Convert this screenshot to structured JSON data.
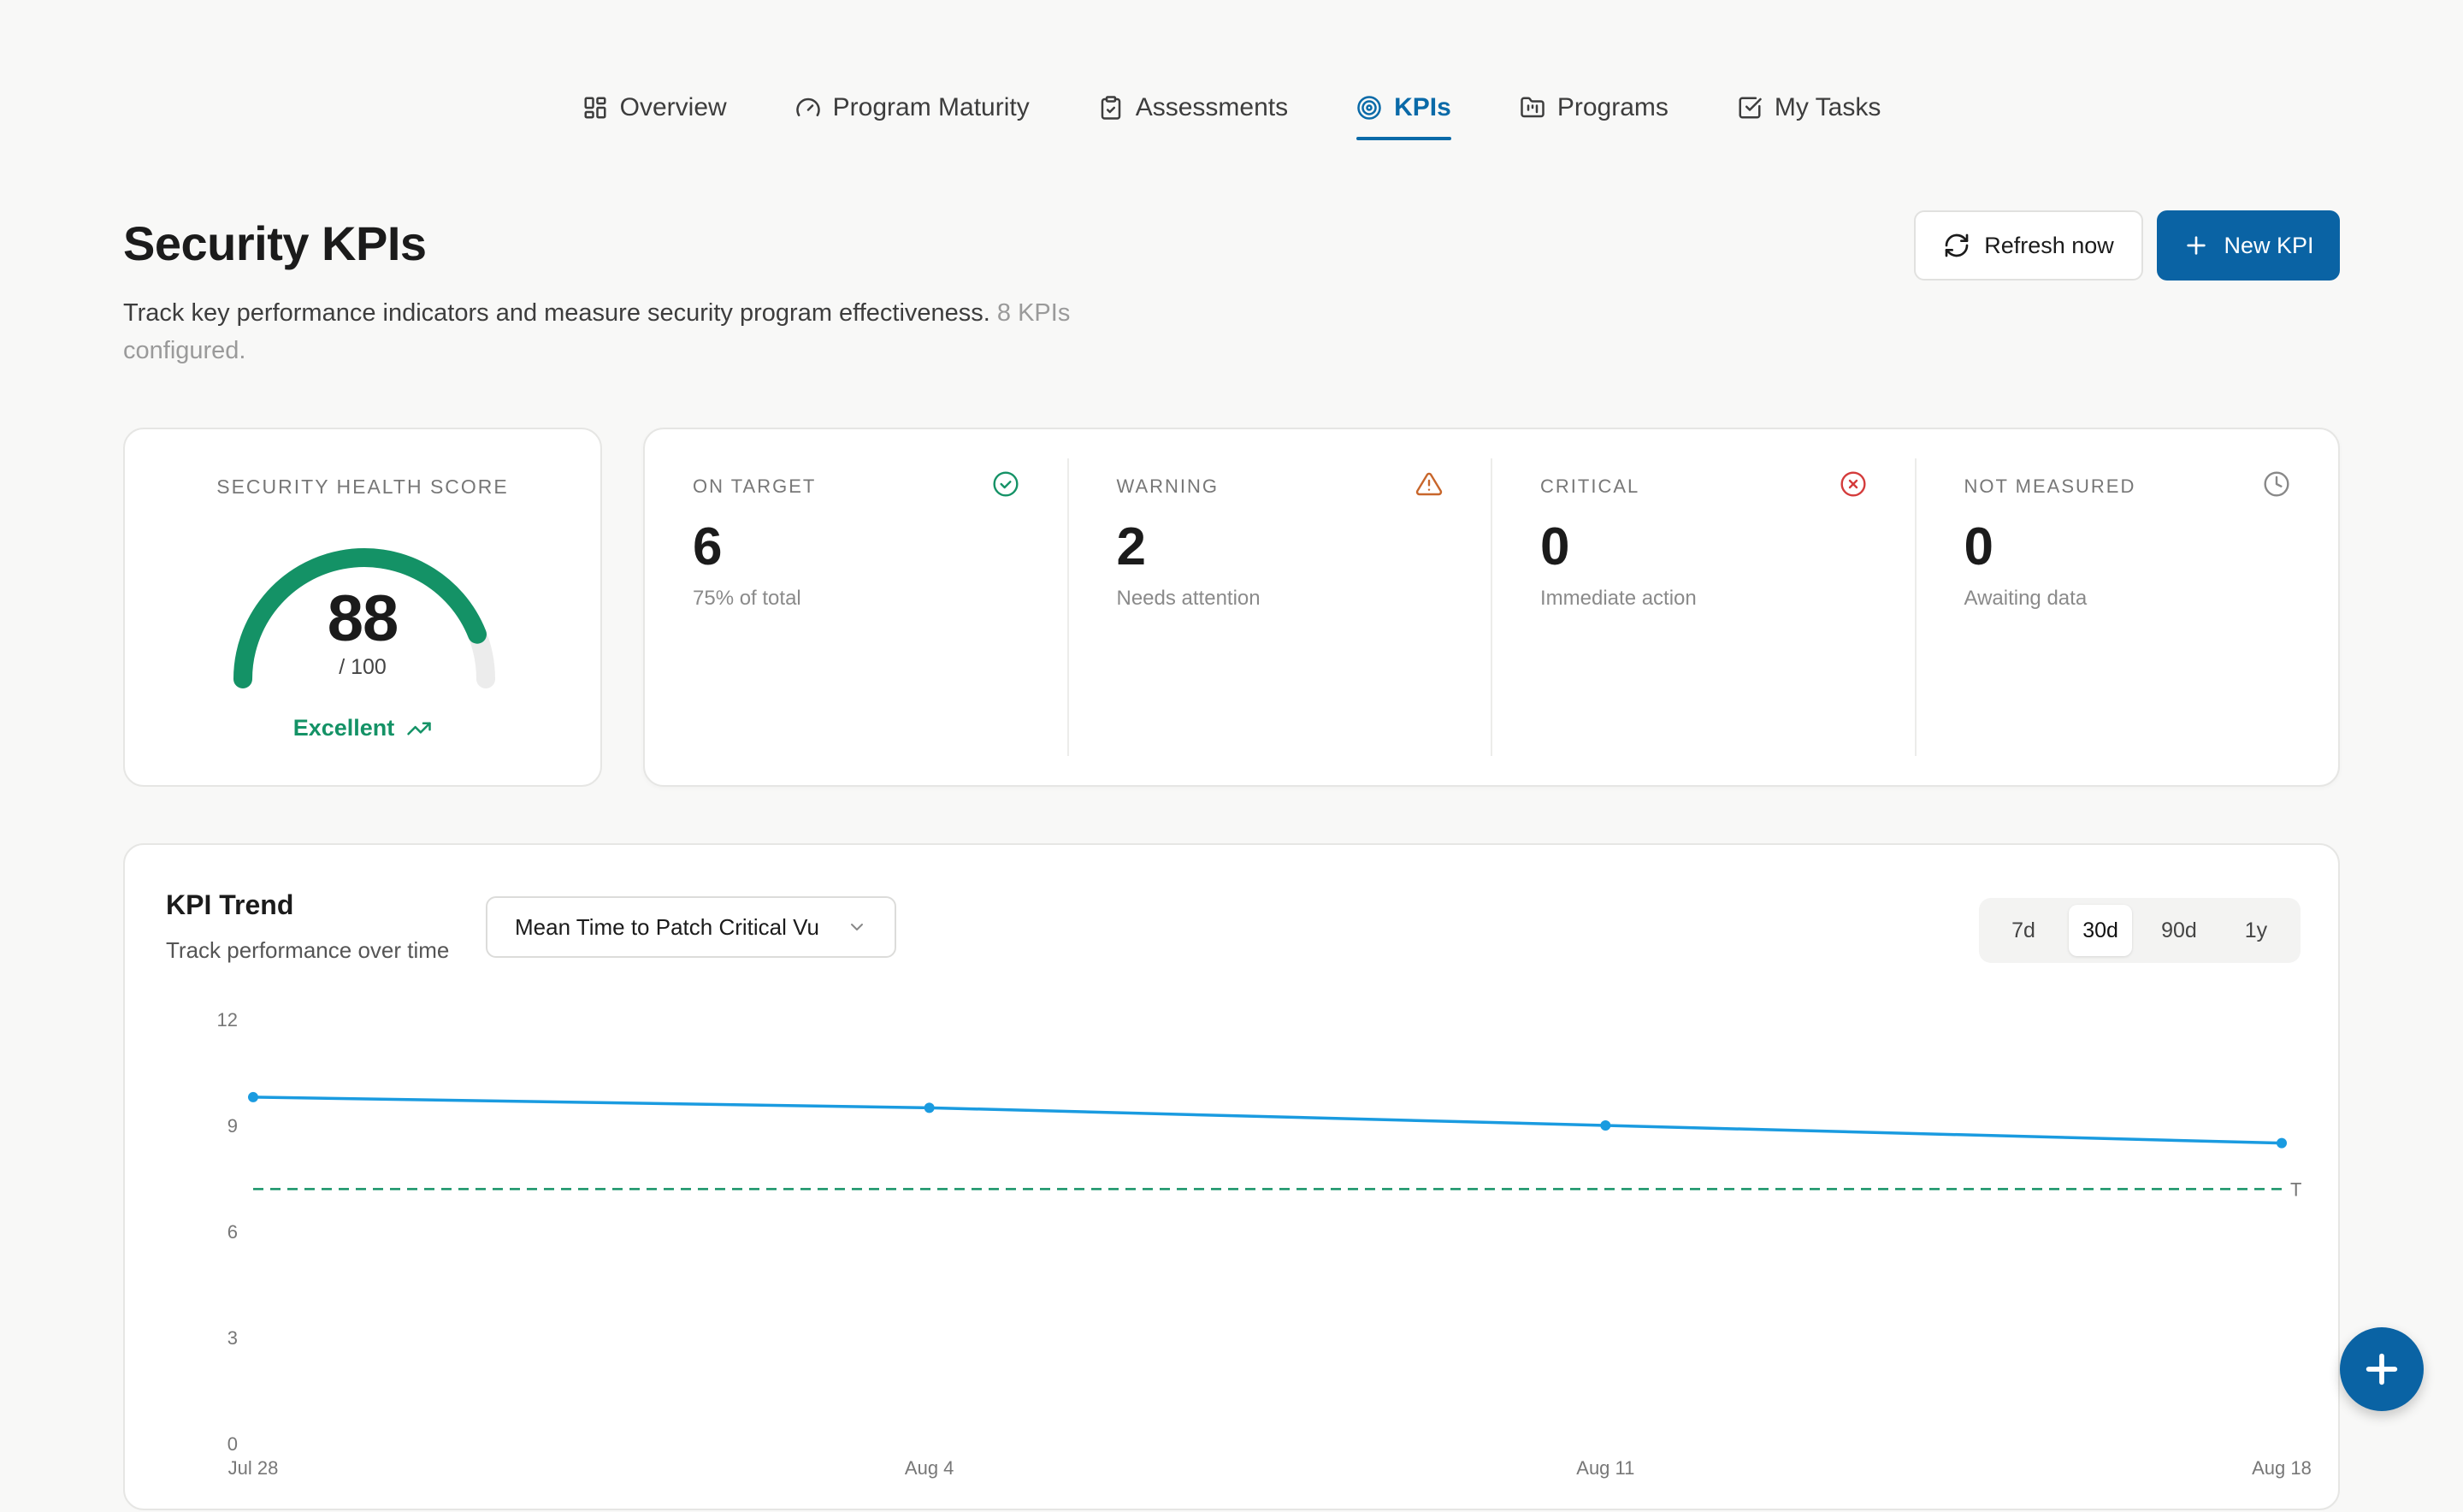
{
  "nav": {
    "items": [
      {
        "label": "Overview",
        "icon": "grid-icon",
        "active": false
      },
      {
        "label": "Program Maturity",
        "icon": "gauge-icon",
        "active": false
      },
      {
        "label": "Assessments",
        "icon": "clipboard-check-icon",
        "active": false
      },
      {
        "label": "KPIs",
        "icon": "target-icon",
        "active": true
      },
      {
        "label": "Programs",
        "icon": "folder-kanban-icon",
        "active": false
      },
      {
        "label": "My Tasks",
        "icon": "square-check-icon",
        "active": false
      }
    ]
  },
  "header": {
    "title": "Security KPIs",
    "subtitle": "Track key performance indicators and measure security program effectiveness.",
    "count_note": "8 KPIs configured.",
    "refresh_label": "Refresh now",
    "new_label": "New KPI"
  },
  "health": {
    "label": "SECURITY HEALTH SCORE",
    "score": "88",
    "max": "/ 100",
    "score_fraction": 0.88,
    "status": "Excellent",
    "color": "#149266"
  },
  "stats": [
    {
      "label": "ON TARGET",
      "value": "6",
      "note": "75% of total",
      "icon": "check-circle-icon",
      "color": "#149266"
    },
    {
      "label": "WARNING",
      "value": "2",
      "note": "Needs attention",
      "icon": "warning-triangle-icon",
      "color": "#c8662b"
    },
    {
      "label": "CRITICAL",
      "value": "0",
      "note": "Immediate action",
      "icon": "x-circle-icon",
      "color": "#d43b3b"
    },
    {
      "label": "NOT MEASURED",
      "value": "0",
      "note": "Awaiting data",
      "icon": "clock-icon",
      "color": "#888888"
    }
  ],
  "trend": {
    "title": "KPI Trend",
    "subtitle": "Track performance over time",
    "selected_kpi": "Mean Time to Patch Critical Vu",
    "ranges": [
      "7d",
      "30d",
      "90d",
      "1y"
    ],
    "active_range": "30d"
  },
  "chart_data": {
    "type": "line",
    "x": [
      "Jul 28",
      "Aug 4",
      "Aug 11",
      "Aug 18"
    ],
    "series": [
      {
        "values": [
          9.8,
          9.5,
          9.0,
          8.5
        ],
        "color": "#1a9be0"
      }
    ],
    "target": {
      "value": 7.2,
      "label": "T",
      "color": "#149266",
      "style": "dashed"
    },
    "yticks": [
      0,
      3,
      6,
      9,
      12
    ],
    "ylim": [
      0,
      12
    ],
    "grid": false
  }
}
